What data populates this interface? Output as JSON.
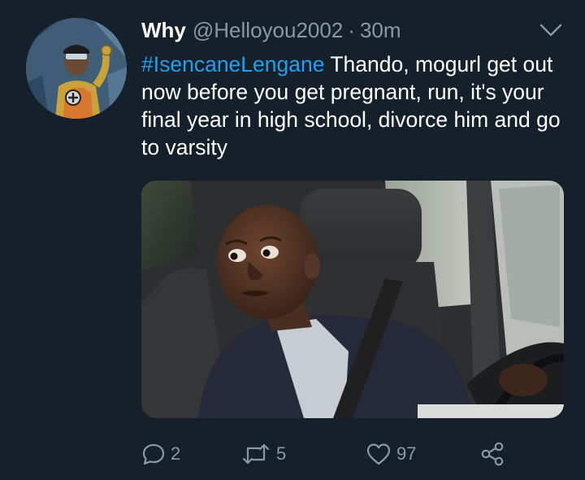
{
  "tweet": {
    "display_name": "Why",
    "handle": "@Helloyou2002",
    "separator": "·",
    "time": "30m",
    "text": {
      "hashtag": "#IsencaneLengane",
      "body": " Thando, mogurl get out now before you get pregnant, run, it's your final year in high school, divorce him and go to varsity"
    }
  },
  "actions": {
    "reply_count": "2",
    "retweet_count": "5",
    "like_count": "97"
  },
  "icons": {
    "caret": "chevron-down-icon",
    "reply": "reply-icon",
    "retweet": "retweet-icon",
    "like": "heart-icon",
    "share": "share-icon"
  },
  "colors": {
    "background": "#15202b",
    "text": "#ffffff",
    "secondary": "#8899a6",
    "hashtag": "#1da1f2"
  }
}
